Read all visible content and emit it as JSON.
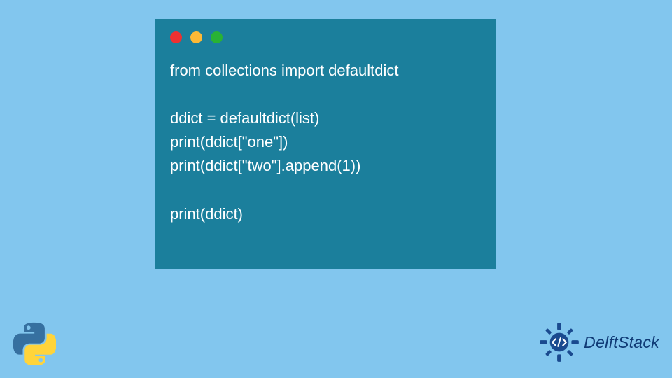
{
  "code": {
    "line1": "from collections import defaultdict",
    "line2": "",
    "line3": "ddict = defaultdict(list)",
    "line4": "print(ddict[\"one\"])",
    "line5": "print(ddict[\"two\"].append(1))",
    "line6": "",
    "line7": "print(ddict)"
  },
  "brand": {
    "name": "DelftStack"
  },
  "colors": {
    "background": "#82c6ee",
    "window": "#1b7f9c",
    "red": "#ed3131",
    "yellow": "#fdb936",
    "green": "#29b234",
    "brand_blue": "#0f3a75"
  }
}
